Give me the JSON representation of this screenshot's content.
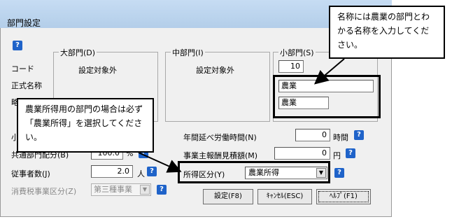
{
  "dialog": {
    "title": "部門設定"
  },
  "labels": {
    "code": "コード",
    "official_name": "正式名称",
    "abbr_fragment": "略",
    "small_fragment": "小",
    "common_ratio": "共通部門配分(B)",
    "workers": "従事者数(J)",
    "tax_category": "消費税事業区分(Z)"
  },
  "groups": {
    "large": {
      "legend": "大部門(D)",
      "value": "設定対象外"
    },
    "medium": {
      "legend": "中部門(I)",
      "value": "設定対象外"
    },
    "small": {
      "legend": "小部門(S)",
      "code": "10",
      "official_name": "農業",
      "abbr_name": "農業"
    }
  },
  "fields": {
    "common_ratio_value": "100.0",
    "common_ratio_unit": "%",
    "workers_value": "2.0",
    "workers_unit": "人",
    "tax_category_value": "第三種事業",
    "annual_hours_label": "年間延べ労働時間(N)",
    "annual_hours_value": "0",
    "annual_hours_unit": "時間",
    "owner_salary_label": "事業主報酬見積額(M)",
    "owner_salary_value": "0",
    "owner_salary_unit": "円",
    "income_category_label": "所得区分(Y)",
    "income_category_value": "農業所得"
  },
  "buttons": {
    "settings": "設定(F8)",
    "cancel": "ｷｬﾝｾﾙ(ESC)",
    "help": "ﾍﾙﾌﾟ(F1)"
  },
  "help_icon_text": "?",
  "callouts": {
    "top_right": "名称には農業の部門とわかる名称を入力してください。",
    "left": "農業所得用の部門の場合は必ず「農業所得」を選択してください。"
  }
}
